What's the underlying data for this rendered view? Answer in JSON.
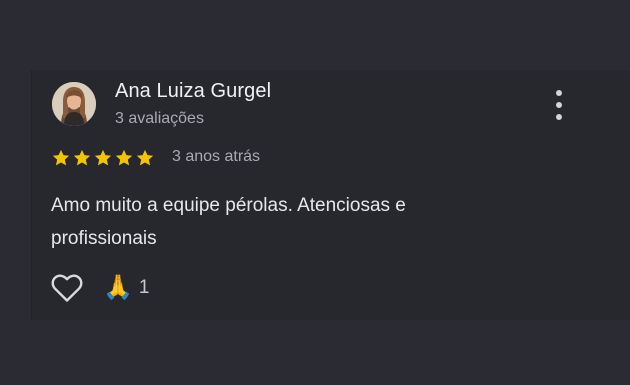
{
  "review": {
    "author": "Ana Luiza Gurgel",
    "review_count": "3 avaliações",
    "rating": 5,
    "time": "3 anos atrás",
    "text": "Amo muito a equipe pérolas. Atenciosas e profissionais",
    "reactions": {
      "like_icon": "heart-outline-icon",
      "emoji_icon": "folded-hands-emoji",
      "emoji": "🙏",
      "count": "1"
    },
    "menu_icon": "more-vert-icon"
  },
  "colors": {
    "background": "#2b2c33",
    "star": "#f5c400",
    "primary_text": "#f1f1f3",
    "secondary_text": "#a9aab2"
  }
}
